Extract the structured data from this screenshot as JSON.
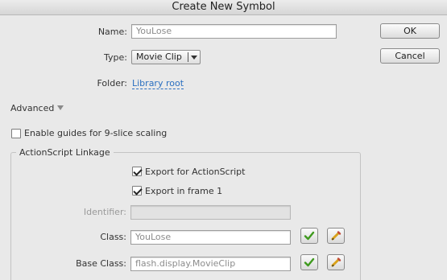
{
  "window": {
    "title": "Create New Symbol"
  },
  "form": {
    "name_label": "Name:",
    "name_value": "YouLose",
    "type_label": "Type:",
    "type_value": "Movie Clip",
    "folder_label": "Folder:",
    "folder_value": "Library root"
  },
  "buttons": {
    "ok": "OK",
    "cancel": "Cancel"
  },
  "advanced": {
    "toggle_label": "Advanced",
    "nine_slice_label": "Enable guides for 9-slice scaling",
    "nine_slice_checked": false
  },
  "linkage": {
    "group_title": "ActionScript Linkage",
    "export_as_label": "Export for ActionScript",
    "export_as_checked": true,
    "export_frame_label": "Export in frame 1",
    "export_frame_checked": true,
    "identifier_label": "Identifier:",
    "identifier_value": "",
    "class_label": "Class:",
    "class_value": "YouLose",
    "base_class_label": "Base Class:",
    "base_class_value": "flash.display.MovieClip"
  },
  "icons": {
    "validate": "checkmark-icon",
    "edit": "pencil-icon"
  },
  "colors": {
    "link": "#2a6fc0",
    "check_green": "#3f9a1e",
    "background": "#e9e9e9"
  }
}
